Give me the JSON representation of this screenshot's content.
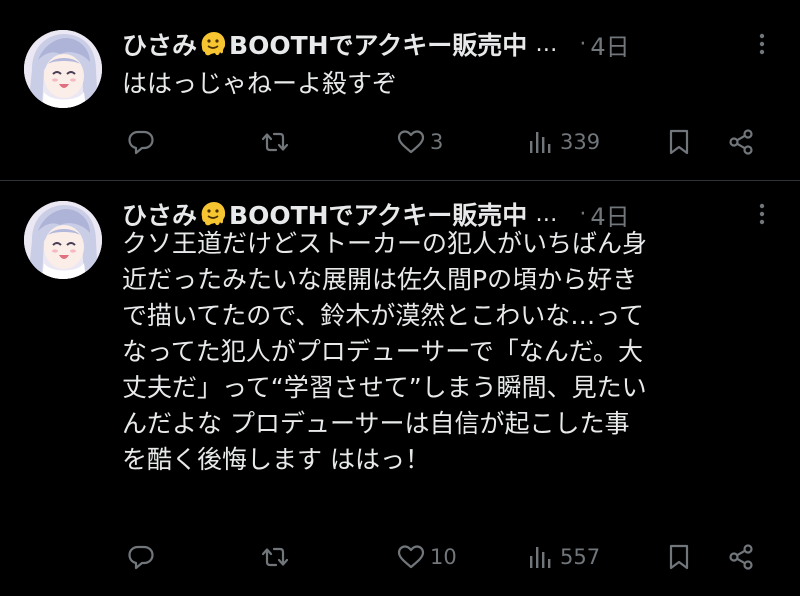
{
  "colors": {
    "background": "#000000",
    "text": "#e7e9ea",
    "muted": "#71767b",
    "divider": "#2f3336"
  },
  "tweets": [
    {
      "author_name": "ひさみ",
      "author_name_suffix": "BOOTHでアクキー販売中",
      "author_emoji": "melting-face-emoji",
      "truncation": "…",
      "separator": "·",
      "time": "4日",
      "text": "ははっじゃねーよ殺すぞ",
      "actions": {
        "reply_icon": "reply-icon",
        "retweet_icon": "retweet-icon",
        "like_icon": "heart-icon",
        "like_count": "3",
        "views_icon": "views-icon",
        "views_count": "339",
        "bookmark_icon": "bookmark-icon",
        "share_icon": "share-icon"
      }
    },
    {
      "author_name": "ひさみ",
      "author_name_suffix": "BOOTHでアクキー販売中",
      "author_emoji": "melting-face-emoji",
      "truncation": "…",
      "separator": "·",
      "time": "4日",
      "text": "クソ王道だけどストーカーの犯人がいちばん身\n近だったみたいな展開は佐久間Pの頃から好き\nで描いてたので、鈴木が漠然とこわいな…って\nなってた犯人がプロデューサーで「なんだ。大\n丈夫だ」って“学習させて”しまう瞬間、見たい\nんだよな プロデューサーは自信が起こした事\nを酷く後悔します ははっ！",
      "actions": {
        "reply_icon": "reply-icon",
        "retweet_icon": "retweet-icon",
        "like_icon": "heart-icon",
        "like_count": "10",
        "views_icon": "views-icon",
        "views_count": "557",
        "bookmark_icon": "bookmark-icon",
        "share_icon": "share-icon"
      }
    }
  ]
}
